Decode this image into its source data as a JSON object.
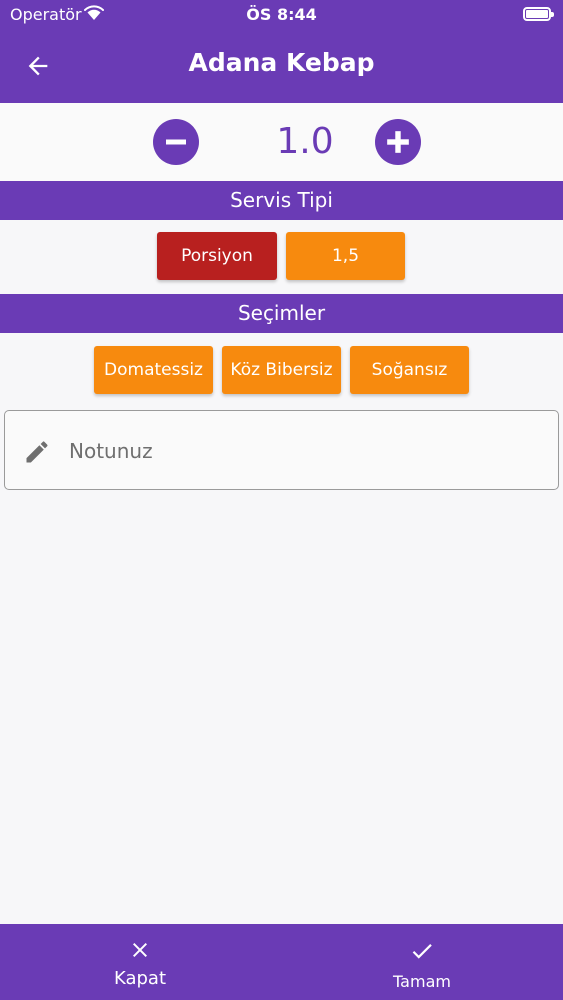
{
  "status_bar": {
    "carrier": "Operatör",
    "time": "ÖS 8:44"
  },
  "header": {
    "title": "Adana Kebap"
  },
  "quantity": {
    "value": "1.0"
  },
  "service_type": {
    "header": "Servis Tipi",
    "options": [
      {
        "label": "Porsiyon",
        "selected": true
      },
      {
        "label": "1,5",
        "selected": false
      }
    ]
  },
  "selections": {
    "header": "Seçimler",
    "options": [
      {
        "label": "Domatessiz"
      },
      {
        "label": "Köz Bibersiz"
      },
      {
        "label": "Soğansız"
      }
    ]
  },
  "note": {
    "placeholder": "Notunuz",
    "value": ""
  },
  "bottom_bar": {
    "close_label": "Kapat",
    "ok_label": "Tamam"
  },
  "colors": {
    "primary": "#6a3bb5",
    "selected_chip": "#b8201f",
    "option_chip": "#f78a0e",
    "background": "#f7f7f9"
  }
}
